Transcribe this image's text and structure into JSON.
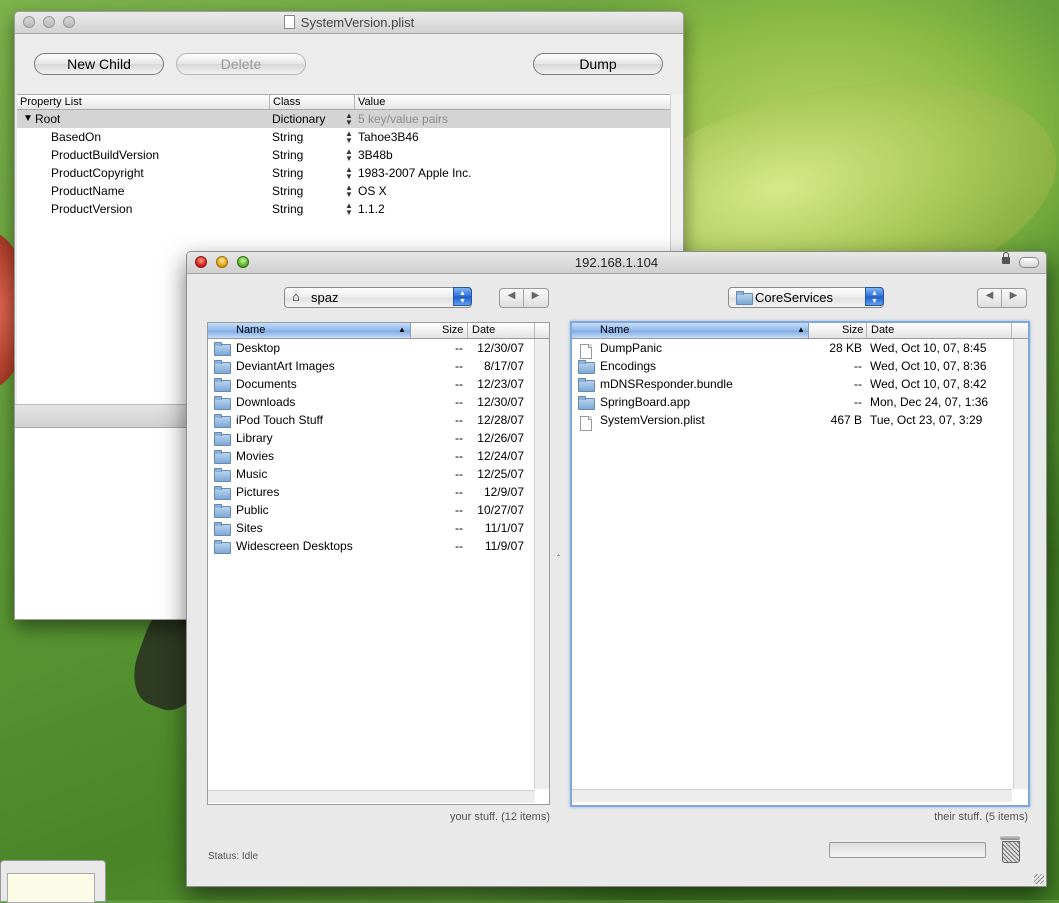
{
  "plist_window": {
    "title": "SystemVersion.plist",
    "buttons": {
      "new_child": "New Child",
      "delete": "Delete",
      "dump": "Dump"
    },
    "columns": {
      "property_list": "Property List",
      "class": "Class",
      "value": "Value"
    },
    "rows": [
      {
        "key": "Root",
        "class": "Dictionary",
        "value": "5 key/value pairs"
      },
      {
        "key": "BasedOn",
        "class": "String",
        "value": "Tahoe3B46"
      },
      {
        "key": "ProductBuildVersion",
        "class": "String",
        "value": "3B48b"
      },
      {
        "key": "ProductCopyright",
        "class": "String",
        "value": "1983-2007 Apple Inc."
      },
      {
        "key": "ProductName",
        "class": "String",
        "value": "OS X"
      },
      {
        "key": "ProductVersion",
        "class": "String",
        "value": "1.1.2"
      }
    ]
  },
  "ftp_window": {
    "title": "192.168.1.104",
    "local": {
      "location": "spaz",
      "columns": {
        "name": "Name",
        "size": "Size",
        "date": "Date"
      },
      "files": [
        {
          "name": "Desktop",
          "size": "--",
          "date": "12/30/07"
        },
        {
          "name": "DeviantArt Images",
          "size": "--",
          "date": "8/17/07"
        },
        {
          "name": "Documents",
          "size": "--",
          "date": "12/23/07"
        },
        {
          "name": "Downloads",
          "size": "--",
          "date": "12/30/07"
        },
        {
          "name": "iPod Touch Stuff",
          "size": "--",
          "date": "12/28/07"
        },
        {
          "name": "Library",
          "size": "--",
          "date": "12/26/07"
        },
        {
          "name": "Movies",
          "size": "--",
          "date": "12/24/07"
        },
        {
          "name": "Music",
          "size": "--",
          "date": "12/25/07"
        },
        {
          "name": "Pictures",
          "size": "--",
          "date": "12/9/07"
        },
        {
          "name": "Public",
          "size": "--",
          "date": "10/27/07"
        },
        {
          "name": "Sites",
          "size": "--",
          "date": "11/1/07"
        },
        {
          "name": "Widescreen Desktops",
          "size": "--",
          "date": "11/9/07"
        }
      ],
      "footer": "your stuff. (12 items)"
    },
    "remote": {
      "location": "CoreServices",
      "columns": {
        "name": "Name",
        "size": "Size",
        "date": "Date"
      },
      "files": [
        {
          "name": "DumpPanic",
          "size": "28 KB",
          "date": "Wed, Oct 10, 07, 8:45",
          "icon": "file"
        },
        {
          "name": "Encodings",
          "size": "--",
          "date": "Wed, Oct 10, 07, 8:36",
          "icon": "folder"
        },
        {
          "name": "mDNSResponder.bundle",
          "size": "--",
          "date": "Wed, Oct 10, 07, 8:42",
          "icon": "folder"
        },
        {
          "name": "SpringBoard.app",
          "size": "--",
          "date": "Mon, Dec 24, 07, 1:36",
          "icon": "folder"
        },
        {
          "name": "SystemVersion.plist",
          "size": "467 B",
          "date": "Tue, Oct 23, 07, 3:29",
          "icon": "file"
        }
      ],
      "footer": "their stuff. (5 items)"
    },
    "status": "Status: Idle"
  }
}
